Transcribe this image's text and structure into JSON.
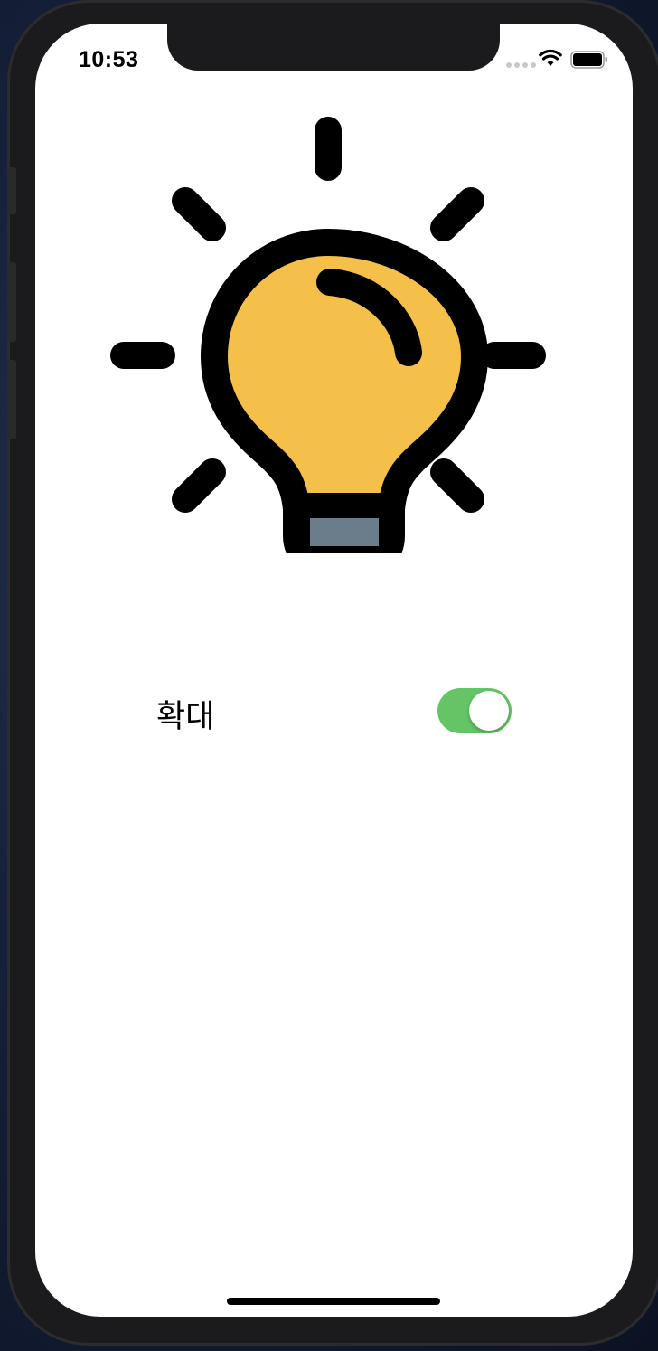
{
  "status_bar": {
    "time": "10:53"
  },
  "main": {
    "illustration": "lightbulb-icon",
    "toggle": {
      "label": "확대",
      "state": "on",
      "color": "#64c466"
    }
  },
  "colors": {
    "bulb_fill": "#f5c04a",
    "bulb_base": "#6b7d8a",
    "outline": "#000000"
  }
}
